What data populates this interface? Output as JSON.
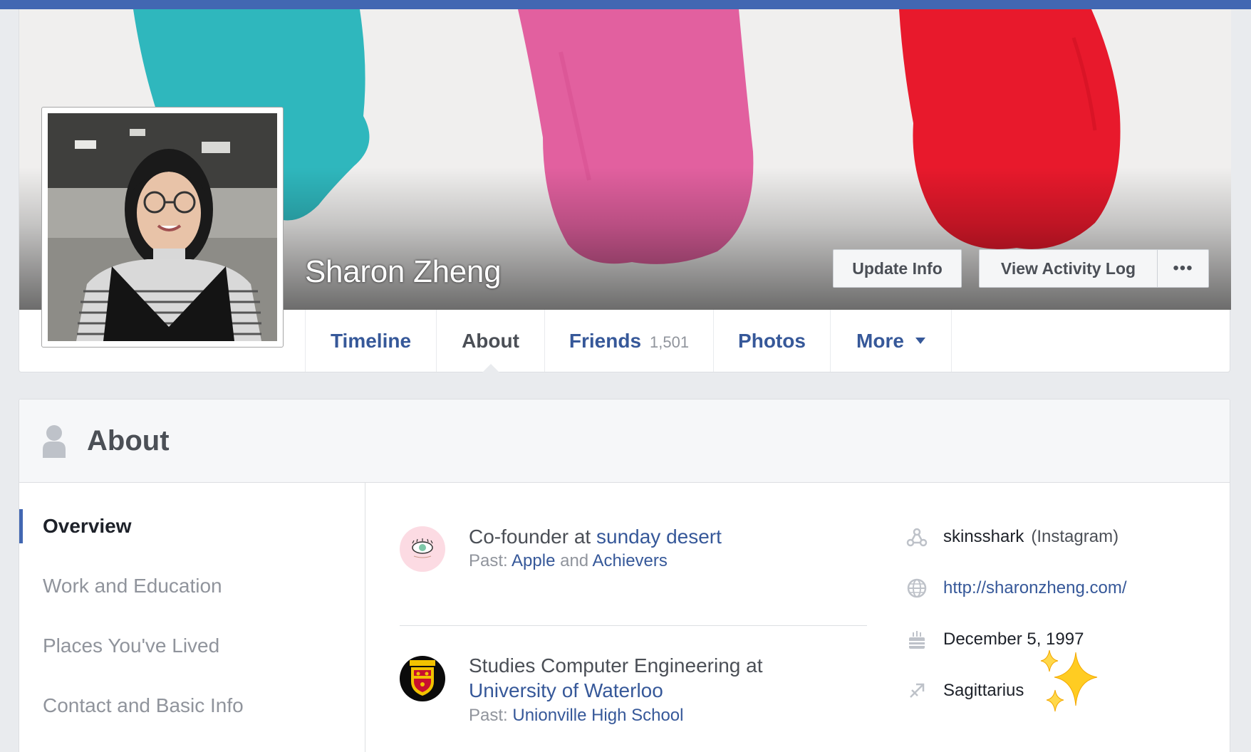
{
  "profile": {
    "name": "Sharon Zheng"
  },
  "header_buttons": {
    "update_info": "Update Info",
    "view_activity_log": "View Activity Log",
    "more_dots": "•••"
  },
  "tabs": [
    {
      "label": "Timeline"
    },
    {
      "label": "About"
    },
    {
      "label": "Friends",
      "count": "1,501"
    },
    {
      "label": "Photos"
    },
    {
      "label": "More"
    }
  ],
  "about": {
    "title": "About",
    "nav": [
      {
        "label": "Overview",
        "active": true
      },
      {
        "label": "Work and Education"
      },
      {
        "label": "Places You've Lived"
      },
      {
        "label": "Contact and Basic Info"
      }
    ],
    "work": {
      "prefix": "Co-founder at ",
      "company": "sunday desert",
      "past_label": "Past: ",
      "past_1": "Apple",
      "past_and": " and ",
      "past_2": "Achievers"
    },
    "education": {
      "prefix": "Studies Computer Engineering at",
      "school": "University of Waterloo",
      "past_label": "Past: ",
      "past_school": "Unionville High School"
    },
    "contact": {
      "instagram_handle": "skinsshark",
      "instagram_label": "(Instagram)",
      "website": "http://sharonzheng.com/",
      "birthday": "December 5, 1997",
      "zodiac": "Sagittarius"
    }
  },
  "colors": {
    "facebook_blue": "#4267b2",
    "link_blue": "#365899",
    "cover_teal": "#2fb7bd",
    "cover_pink": "#e2609f",
    "cover_red": "#e8192c"
  },
  "icons": {
    "instagram": "instagram-icon",
    "website": "globe-icon",
    "birthday": "cake-icon",
    "zodiac": "sagittarius-arrow-icon",
    "sparkles": "sparkles-emoji",
    "about_header": "person-icon"
  }
}
